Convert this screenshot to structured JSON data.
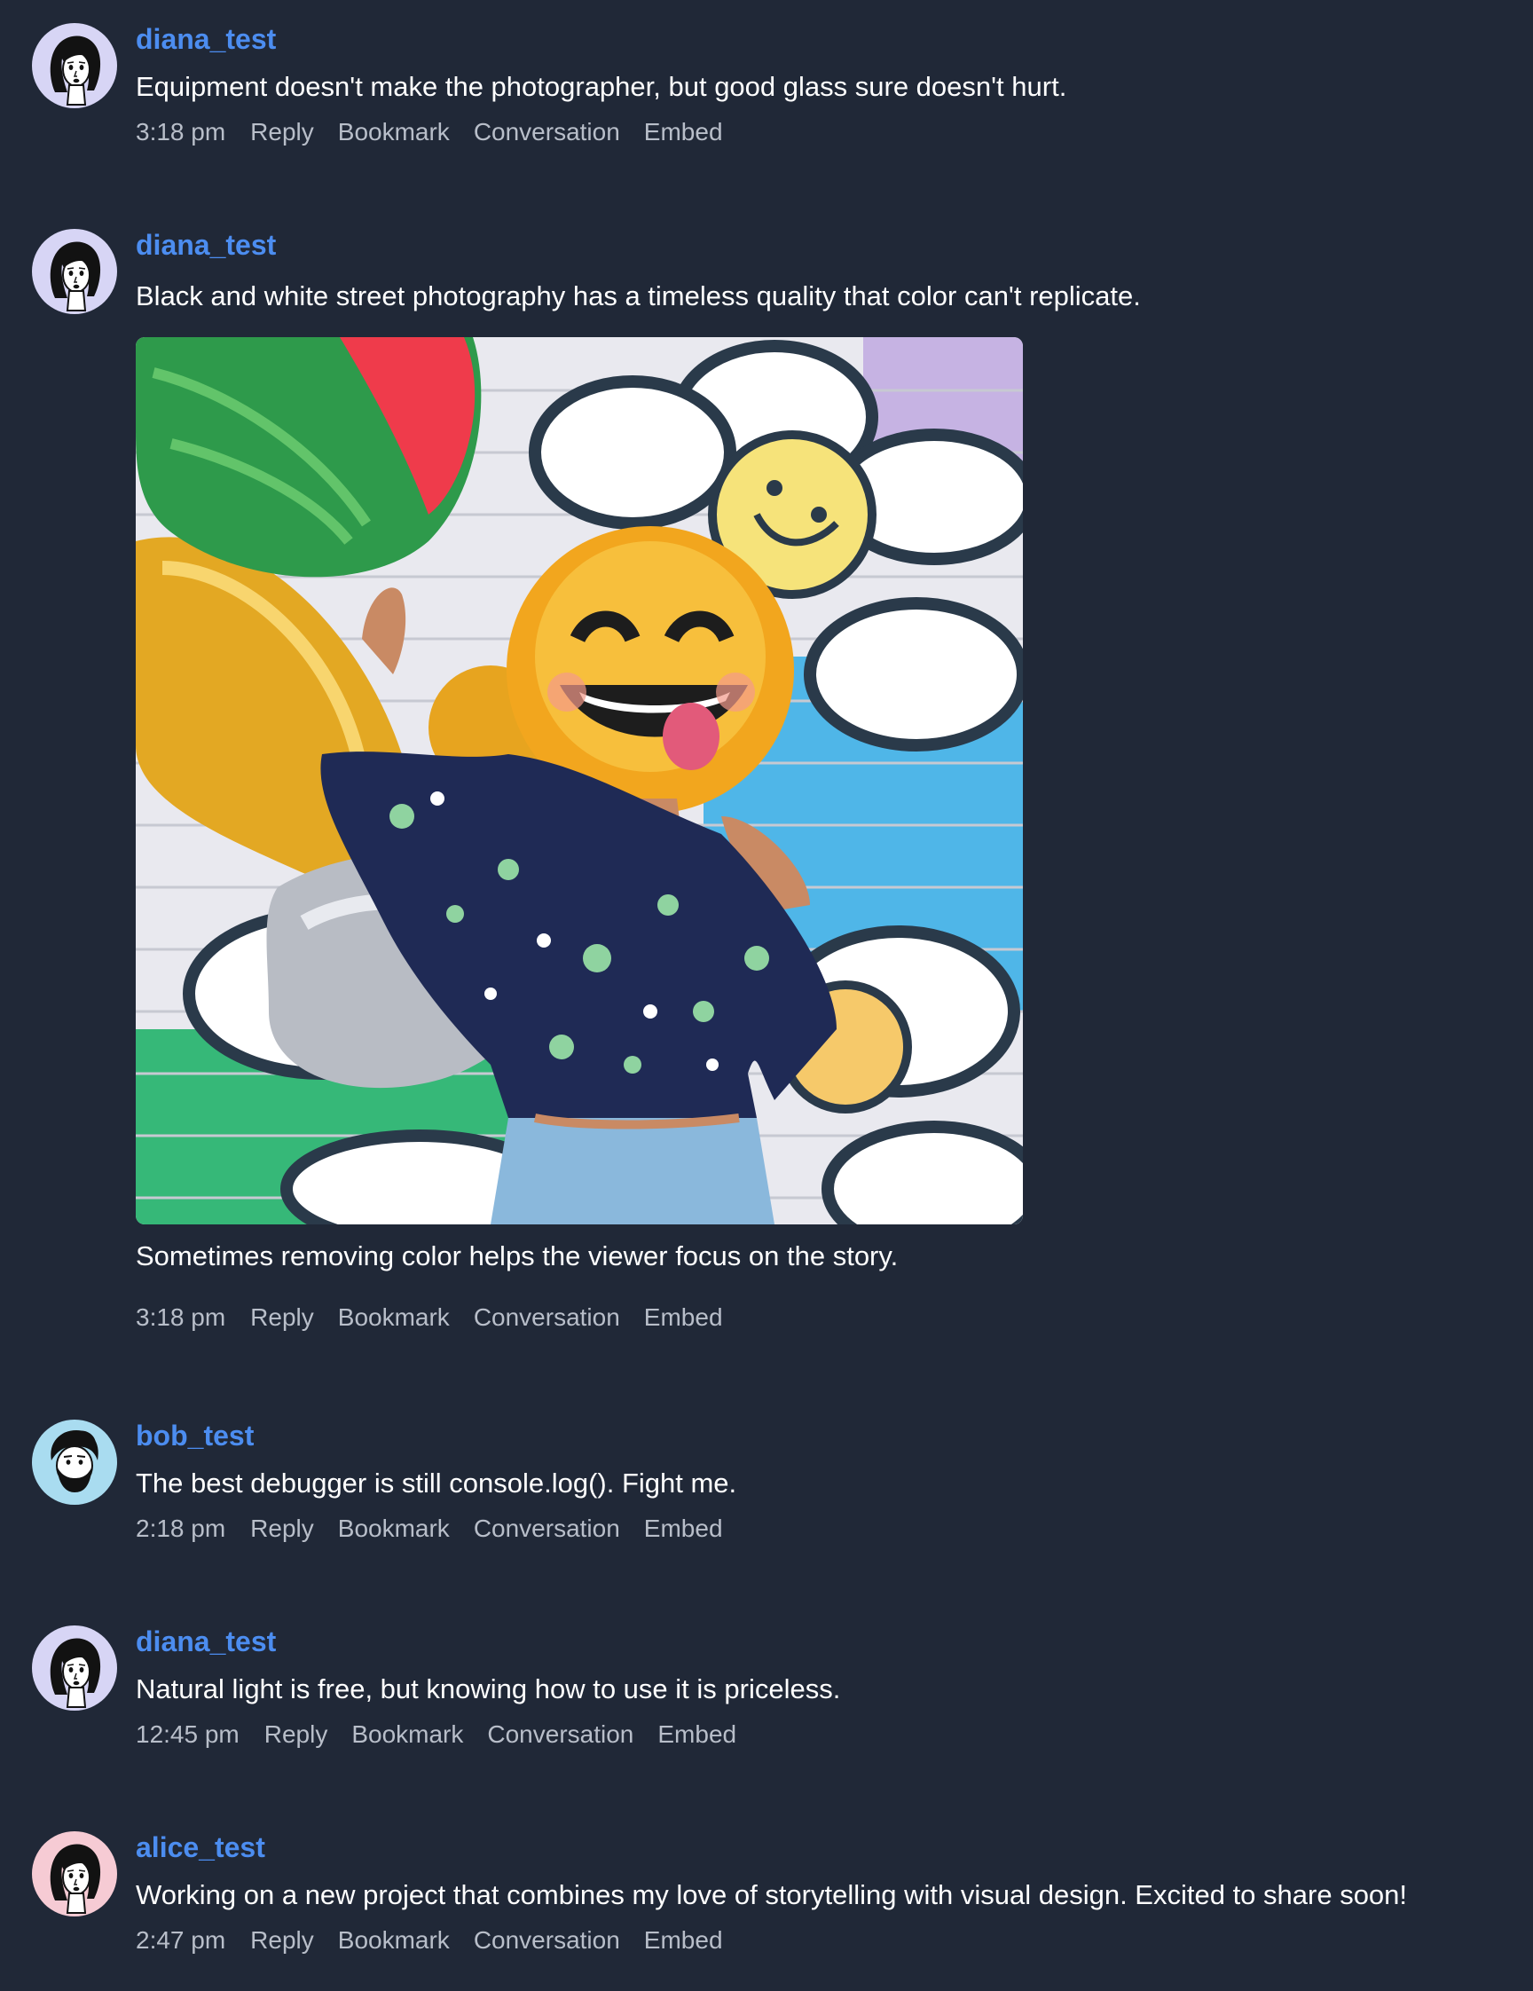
{
  "posts": [
    {
      "username": "diana_test",
      "avatar": "woman-avatar-icon",
      "avatar_bg": "#d7d5f5",
      "text": "Equipment doesn't make the photographer, but good glass sure doesn't hurt.",
      "time": "3:18 pm",
      "actions": [
        "Reply",
        "Bookmark",
        "Conversation",
        "Embed"
      ]
    },
    {
      "username": "diana_test",
      "avatar": "woman-avatar-icon",
      "avatar_bg": "#d7d5f5",
      "text": "Black and white street photography has a timeless quality that color can't replicate.",
      "image": "photo of woman holding smiley-face balloon in front of flower graffiti wall",
      "caption": "Sometimes removing color helps the viewer focus on the story.",
      "time": "3:18 pm",
      "actions": [
        "Reply",
        "Bookmark",
        "Conversation",
        "Embed"
      ]
    },
    {
      "username": "bob_test",
      "avatar": "bearded-man-avatar-icon",
      "avatar_bg": "#a9dcf0",
      "text": "The best debugger is still console.log(). Fight me.",
      "time": "2:18 pm",
      "actions": [
        "Reply",
        "Bookmark",
        "Conversation",
        "Embed"
      ]
    },
    {
      "username": "diana_test",
      "avatar": "woman-avatar-icon",
      "avatar_bg": "#d7d5f5",
      "text": "Natural light is free, but knowing how to use it is priceless.",
      "time": "12:45 pm",
      "actions": [
        "Reply",
        "Bookmark",
        "Conversation",
        "Embed"
      ]
    },
    {
      "username": "alice_test",
      "avatar": "woman-avatar-icon",
      "avatar_bg": "#f6cbd4",
      "text": "Working on a new project that combines my love of storytelling with visual design. Excited to share soon!",
      "time": "2:47 pm",
      "actions": [
        "Reply",
        "Bookmark",
        "Conversation",
        "Embed"
      ]
    }
  ],
  "colors": {
    "background": "#202837",
    "username": "#4c8df0",
    "text": "#ffffff",
    "meta": "#b8bec9"
  }
}
